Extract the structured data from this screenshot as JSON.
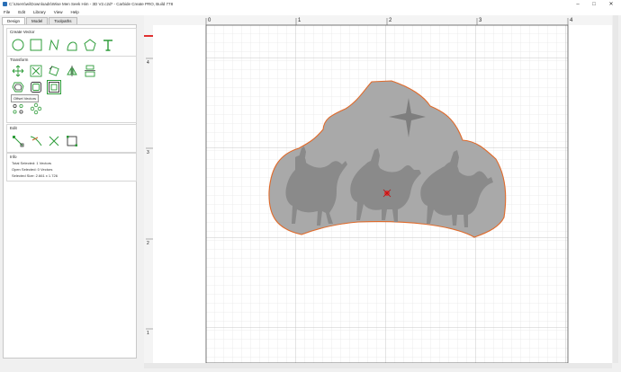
{
  "window": {
    "title": "C:\\Users\\wi\\Downloads\\Wise Men Seek Him - 3D V2.c2d* - Carbide Create PRO, Build 778",
    "minimize_icon": "minimize-icon",
    "maximize_icon": "maximize-icon",
    "close_icon": "close-icon"
  },
  "menu": [
    "File",
    "Edit",
    "Library",
    "View",
    "Help"
  ],
  "tabs": [
    "Design",
    "Model",
    "Toolpaths"
  ],
  "panel": {
    "create_vector": {
      "title": "Create Vector",
      "tools": [
        "circle-icon",
        "rectangle-icon",
        "polyline-icon",
        "curve-icon",
        "polygon-icon",
        "text-icon"
      ]
    },
    "transform": {
      "title": "Transform",
      "tools": [
        "move-icon",
        "scale-icon",
        "rotate-icon",
        "mirror-icon",
        "align-icon",
        "offset-icon",
        "boolean-icon",
        "boundary-icon",
        "circular-array-icon",
        "array-icon"
      ],
      "tooltip": "Offset Vectors"
    },
    "edit": {
      "title": "Edit",
      "tools": [
        "node-edit-icon",
        "trim-icon",
        "join-icon",
        "bounding-box-icon"
      ]
    },
    "info": {
      "title": "Info",
      "total_selected": "Total Selected:  1 Vectors",
      "open_selected": "Open Selected:  0 Vectors",
      "selected_size": "Selected Size:  2.661 x 1.726"
    }
  },
  "canvas": {
    "ruler_x_labels": [
      "0",
      "1",
      "2",
      "3",
      "4"
    ],
    "ruler_y_labels": [
      "4",
      "3",
      "2",
      "1"
    ],
    "accent": "#e06a2a",
    "shape_fill": "#a9a9a9",
    "ruler_marker_color": "#e03030"
  }
}
